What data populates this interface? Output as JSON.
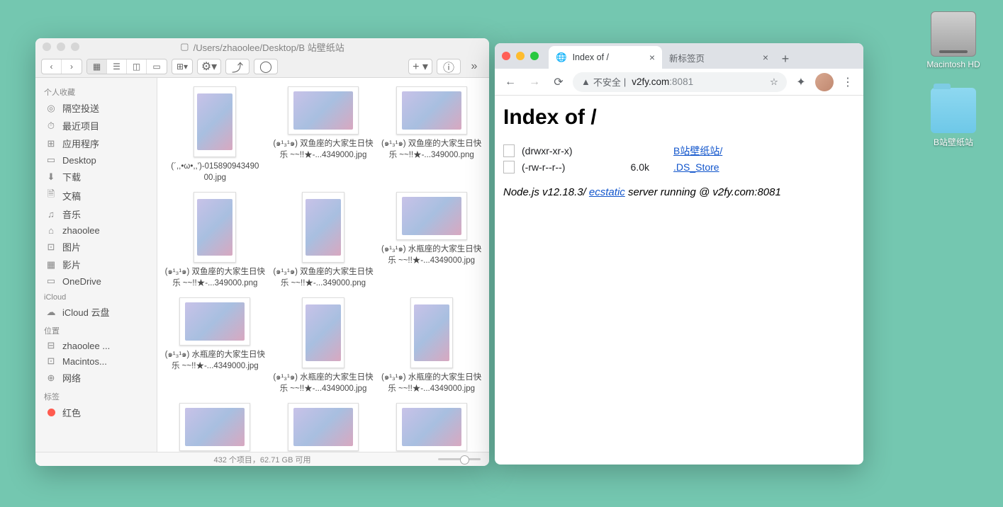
{
  "desktop": {
    "hd_label": "Macintosh HD",
    "folder_label": "B站壁纸站"
  },
  "finder": {
    "path": "/Users/zhaoolee/Desktop/B 站壁纸站",
    "sidebar": {
      "sections": [
        {
          "title": "个人收藏",
          "items": [
            {
              "icon": "◎",
              "label": "隔空投送"
            },
            {
              "icon": "⏱",
              "label": "最近项目"
            },
            {
              "icon": "⊞",
              "label": "应用程序"
            },
            {
              "icon": "▭",
              "label": "Desktop"
            },
            {
              "icon": "⬇",
              "label": "下载"
            },
            {
              "icon": "🗎",
              "label": "文稿"
            },
            {
              "icon": "♫",
              "label": "音乐"
            },
            {
              "icon": "⌂",
              "label": "zhaoolee"
            },
            {
              "icon": "⊡",
              "label": "图片"
            },
            {
              "icon": "▦",
              "label": "影片"
            },
            {
              "icon": "▭",
              "label": "OneDrive"
            }
          ]
        },
        {
          "title": "iCloud",
          "items": [
            {
              "icon": "☁",
              "label": "iCloud 云盘"
            }
          ]
        },
        {
          "title": "位置",
          "items": [
            {
              "icon": "⊟",
              "label": "zhaoolee ..."
            },
            {
              "icon": "⊡",
              "label": "Macintos..."
            },
            {
              "icon": "⊕",
              "label": "网络"
            }
          ]
        },
        {
          "title": "标签",
          "items": [
            {
              "icon": "●",
              "label": "红色",
              "color": "#ff5b4f"
            }
          ]
        }
      ]
    },
    "files": [
      {
        "name": "(´,,•ω•,,')-015890943490\n00.jpg",
        "orient": "portrait"
      },
      {
        "name": "(๑¹₃¹๑) 双鱼座的大家生日快乐 ~~!!★-...4349000.jpg",
        "orient": "landscape"
      },
      {
        "name": "(๑¹₃¹๑) 双鱼座的大家生日快乐 ~~!!★-...349000.png",
        "orient": "landscape"
      },
      {
        "name": "(๑¹₃¹๑) 双鱼座的大家生日快乐 ~~!!★-...349000.png",
        "orient": "portrait"
      },
      {
        "name": "(๑¹₃¹๑) 双鱼座的大家生日快乐 ~~!!★-...349000.png",
        "orient": "portrait"
      },
      {
        "name": "(๑¹₃¹๑) 水瓶座的大家生日快乐 ~~!!★-...4349000.jpg",
        "orient": "landscape"
      },
      {
        "name": "(๑¹₃¹๑) 水瓶座的大家生日快乐 ~~!!★-...4349000.jpg",
        "orient": "landscape"
      },
      {
        "name": "(๑¹₃¹๑) 水瓶座的大家生日快乐 ~~!!★-...4349000.jpg",
        "orient": "portrait"
      },
      {
        "name": "(๑¹₃¹๑) 水瓶座的大家生日快乐 ~~!!★-...4349000.jpg",
        "orient": "portrait"
      },
      {
        "name": "",
        "orient": "landscape"
      },
      {
        "name": "",
        "orient": "landscape"
      },
      {
        "name": "",
        "orient": "landscape"
      }
    ],
    "status": "432 个项目，62.71 GB 可用"
  },
  "chrome": {
    "tabs": [
      {
        "title": "Index of /",
        "active": true
      },
      {
        "title": "新标签页",
        "active": false
      }
    ],
    "address": {
      "warning": "不安全",
      "host": "v2fy.com",
      "port": ":8081"
    },
    "page": {
      "heading": "Index of /",
      "entries": [
        {
          "perm": "(drwxr-xr-x)",
          "size": "",
          "link": "B站壁纸站/"
        },
        {
          "perm": "(-rw-r--r--)",
          "size": "6.0k",
          "link": ".DS_Store"
        }
      ],
      "footer_prefix": "Node.js v12.18.3/ ",
      "footer_link": "ecstatic",
      "footer_suffix": " server running @ v2fy.com:8081"
    }
  }
}
